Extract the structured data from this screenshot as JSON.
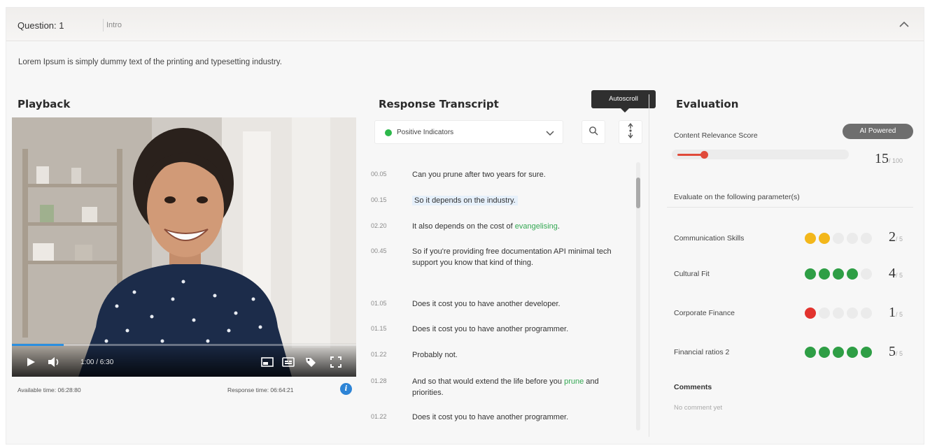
{
  "question": {
    "title": "Question: 1",
    "subtitle": "Intro",
    "description": "Lorem Ipsum is simply dummy text of the printing and typesetting industry."
  },
  "playback": {
    "title": "Playback",
    "timecode": "1:00 / 6:30",
    "progress": 0.15,
    "available_time": "Available time:   06:28:80",
    "response_time": "Response time:   06:64:21"
  },
  "transcript": {
    "title": "Response Transcript",
    "filter_label": "Positive Indicators",
    "autoscroll_tooltip": "Autoscroll",
    "rows": [
      {
        "time": "00.05",
        "text": "Can you prune after two years for sure."
      },
      {
        "time": "00.15",
        "text": "So it depends on the industry."
      },
      {
        "time": "02.20",
        "text_before": "It also depends on the cost of ",
        "text_green": "evangelising",
        "text_after": "."
      },
      {
        "time": "00.45",
        "text": "So if you're providing free documentation API minimal tech support you know that kind of thing."
      },
      {
        "time": "01.05",
        "text": "Does it cost you to have another developer."
      },
      {
        "time": "01.15",
        "text": "Does it cost you to have another programmer."
      },
      {
        "time": "01.22",
        "text": "Probably not."
      },
      {
        "time": "01.28",
        "text_before": "And so that would extend the life before you ",
        "text_green": "prune",
        "text_after": " and priorities."
      },
      {
        "time": "01.22",
        "text": "Does it cost you to have another programmer."
      }
    ]
  },
  "evaluation": {
    "title": "Evaluation",
    "relevance_label": "Content Relevance Score",
    "ai_badge": "AI Powered",
    "relevance_score": "15",
    "relevance_max": "/ 100",
    "relevance_value": 15,
    "params_label": "Evaluate on the following parameter(s)",
    "parameters": [
      {
        "name": "Communication Skills",
        "score": "2",
        "max": "/ 5",
        "value": 2,
        "color": "#f3b71b"
      },
      {
        "name": "Cultural Fit",
        "score": "4",
        "max": "/ 5",
        "value": 4,
        "color": "#2e9e45"
      },
      {
        "name": "Corporate Finance",
        "score": "1",
        "max": "/ 5",
        "value": 1,
        "color": "#e2332e"
      },
      {
        "name": "Financial ratios 2",
        "score": "5",
        "max": "/ 5",
        "value": 5,
        "color": "#2e9e45"
      }
    ],
    "comments_title": "Comments",
    "comments_text": "No comment yet"
  }
}
